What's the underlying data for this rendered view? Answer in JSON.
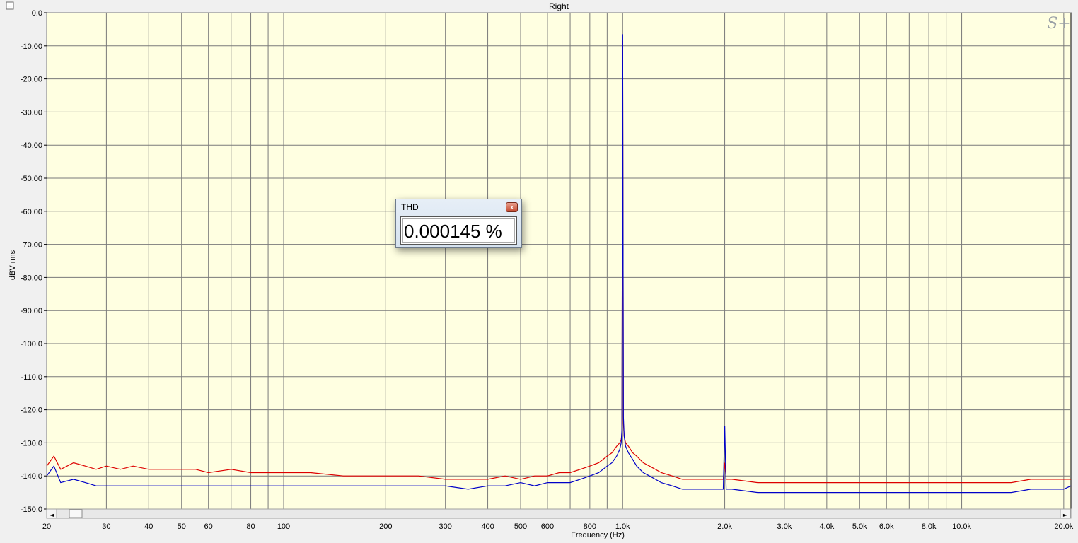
{
  "window": {
    "title": "Right",
    "collapse_glyph": "−",
    "logo_text": "S+"
  },
  "scrollbar": {
    "left_arrow": "◄",
    "right_arrow": "►"
  },
  "thd_dialog": {
    "title": "THD",
    "close_glyph": "x",
    "value": "0.000145 %"
  },
  "colors": {
    "plot_background": "#ffffe1",
    "grid": "#7a7a7a",
    "series_red": "#dd0000",
    "series_blue": "#0000c8",
    "axis_text": "#000000"
  },
  "chart_data": {
    "type": "line",
    "title": "Right",
    "xlabel": "Frequency (Hz)",
    "ylabel": "dBV rms",
    "x_scale": "log",
    "xlim": [
      20,
      21000
    ],
    "ylim": [
      -150,
      0
    ],
    "grid": true,
    "y_ticks": [
      {
        "value": 0,
        "label": "0.0"
      },
      {
        "value": -10,
        "label": "-10.00"
      },
      {
        "value": -20,
        "label": "-20.00"
      },
      {
        "value": -30,
        "label": "-30.00"
      },
      {
        "value": -40,
        "label": "-40.00"
      },
      {
        "value": -50,
        "label": "-50.00"
      },
      {
        "value": -60,
        "label": "-60.00"
      },
      {
        "value": -70,
        "label": "-70.00"
      },
      {
        "value": -80,
        "label": "-80.00"
      },
      {
        "value": -90,
        "label": "-90.00"
      },
      {
        "value": -100,
        "label": "-100.0"
      },
      {
        "value": -110,
        "label": "-110.0"
      },
      {
        "value": -120,
        "label": "-120.0"
      },
      {
        "value": -130,
        "label": "-130.0"
      },
      {
        "value": -140,
        "label": "-140.0"
      },
      {
        "value": -150,
        "label": "-150.0"
      }
    ],
    "x_ticks": [
      {
        "value": 20,
        "label": "20"
      },
      {
        "value": 30,
        "label": "30"
      },
      {
        "value": 40,
        "label": "40"
      },
      {
        "value": 50,
        "label": "50"
      },
      {
        "value": 60,
        "label": "60"
      },
      {
        "value": 80,
        "label": "80"
      },
      {
        "value": 100,
        "label": "100"
      },
      {
        "value": 200,
        "label": "200"
      },
      {
        "value": 300,
        "label": "300"
      },
      {
        "value": 400,
        "label": "400"
      },
      {
        "value": 500,
        "label": "500"
      },
      {
        "value": 600,
        "label": "600"
      },
      {
        "value": 800,
        "label": "800"
      },
      {
        "value": 1000,
        "label": "1.0k"
      },
      {
        "value": 2000,
        "label": "2.0k"
      },
      {
        "value": 3000,
        "label": "3.0k"
      },
      {
        "value": 4000,
        "label": "4.0k"
      },
      {
        "value": 5000,
        "label": "5.0k"
      },
      {
        "value": 6000,
        "label": "6.0k"
      },
      {
        "value": 8000,
        "label": "8.0k"
      },
      {
        "value": 10000,
        "label": "10.0k"
      },
      {
        "value": 20000,
        "label": "20.0k"
      }
    ],
    "x_minor_grid": [
      70,
      90,
      700,
      900,
      7000,
      9000
    ],
    "series": [
      {
        "color": "#dd0000",
        "x": [
          20,
          21,
          22,
          24,
          26,
          28,
          30,
          33,
          36,
          40,
          45,
          50,
          55,
          60,
          70,
          80,
          90,
          100,
          120,
          150,
          200,
          250,
          300,
          350,
          400,
          450,
          500,
          550,
          600,
          650,
          700,
          750,
          800,
          850,
          900,
          930,
          960,
          980,
          990,
          995,
          1000,
          1005,
          1010,
          1020,
          1040,
          1070,
          1100,
          1150,
          1200,
          1300,
          1400,
          1500,
          1700,
          1900,
          1980,
          2000,
          2020,
          2100,
          2500,
          3000,
          3500,
          4000,
          5000,
          6000,
          7000,
          8000,
          10000,
          12000,
          14000,
          16000,
          18000,
          20000,
          21000
        ],
        "y": [
          -137,
          -134,
          -138,
          -136,
          -137,
          -138,
          -137,
          -138,
          -137,
          -138,
          -138,
          -138,
          -138,
          -139,
          -138,
          -139,
          -139,
          -139,
          -139,
          -140,
          -140,
          -140,
          -141,
          -141,
          -141,
          -140,
          -141,
          -140,
          -140,
          -139,
          -139,
          -138,
          -137,
          -136,
          -134,
          -133,
          -131,
          -130,
          -129,
          -127,
          -8.5,
          -124,
          -128,
          -130,
          -131,
          -133,
          -134,
          -136,
          -137,
          -139,
          -140,
          -141,
          -141,
          -141,
          -141,
          -136,
          -141,
          -141,
          -142,
          -142,
          -142,
          -142,
          -142,
          -142,
          -142,
          -142,
          -142,
          -142,
          -142,
          -141,
          -141,
          -141,
          -141
        ]
      },
      {
        "color": "#0000c8",
        "x": [
          20,
          21,
          22,
          24,
          26,
          28,
          30,
          33,
          36,
          40,
          45,
          50,
          55,
          60,
          70,
          80,
          90,
          100,
          120,
          150,
          200,
          250,
          300,
          350,
          400,
          450,
          500,
          550,
          600,
          650,
          700,
          750,
          800,
          850,
          900,
          930,
          960,
          980,
          990,
          995,
          1000,
          1005,
          1010,
          1020,
          1040,
          1070,
          1100,
          1150,
          1200,
          1300,
          1400,
          1500,
          1700,
          1900,
          1980,
          2000,
          2020,
          2100,
          2500,
          3000,
          3500,
          4000,
          5000,
          6000,
          7000,
          8000,
          10000,
          12000,
          14000,
          16000,
          18000,
          20000,
          21000
        ],
        "y": [
          -140,
          -137,
          -142,
          -141,
          -142,
          -143,
          -143,
          -143,
          -143,
          -143,
          -143,
          -143,
          -143,
          -143,
          -143,
          -143,
          -143,
          -143,
          -143,
          -143,
          -143,
          -143,
          -143,
          -144,
          -143,
          -143,
          -142,
          -143,
          -142,
          -142,
          -142,
          -141,
          -140,
          -139,
          -137,
          -136,
          -134,
          -132,
          -130,
          -126,
          -6.5,
          -122,
          -128,
          -131,
          -133,
          -135,
          -137,
          -139,
          -140,
          -142,
          -143,
          -144,
          -144,
          -144,
          -144,
          -125,
          -144,
          -144,
          -145,
          -145,
          -145,
          -145,
          -145,
          -145,
          -145,
          -145,
          -145,
          -145,
          -145,
          -144,
          -144,
          -144,
          -143
        ]
      }
    ]
  }
}
